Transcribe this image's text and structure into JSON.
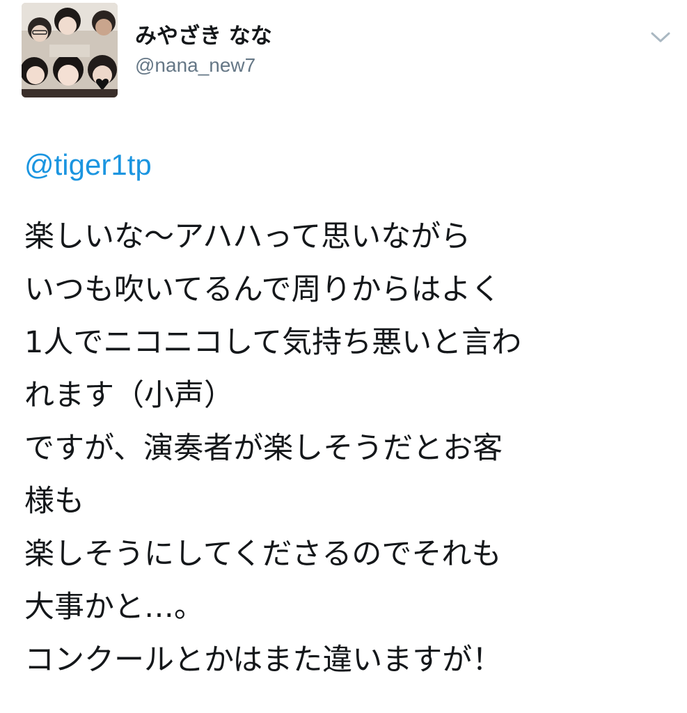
{
  "tweet": {
    "author": {
      "display_name": "みやざき なな",
      "username": "@nana_new7",
      "avatar_icon": "group-photo-avatar"
    },
    "menu_icon": "chevron-down-icon",
    "mention": "@tiger1tp",
    "lines": [
      "楽しいな〜アハハって思いながら",
      "いつも吹いてるんで周りからはよく",
      "1人でニコニコして気持ち悪いと言わ",
      "れます（小声）",
      "ですが、演奏者が楽しそうだとお客",
      "様も",
      "楽しそうにしてくださるのでそれも",
      "大事かと…。",
      "コンクールとかはまた違いますが！"
    ],
    "colors": {
      "link": "#1b95e0",
      "text": "#14171a",
      "secondary": "#657786"
    }
  }
}
